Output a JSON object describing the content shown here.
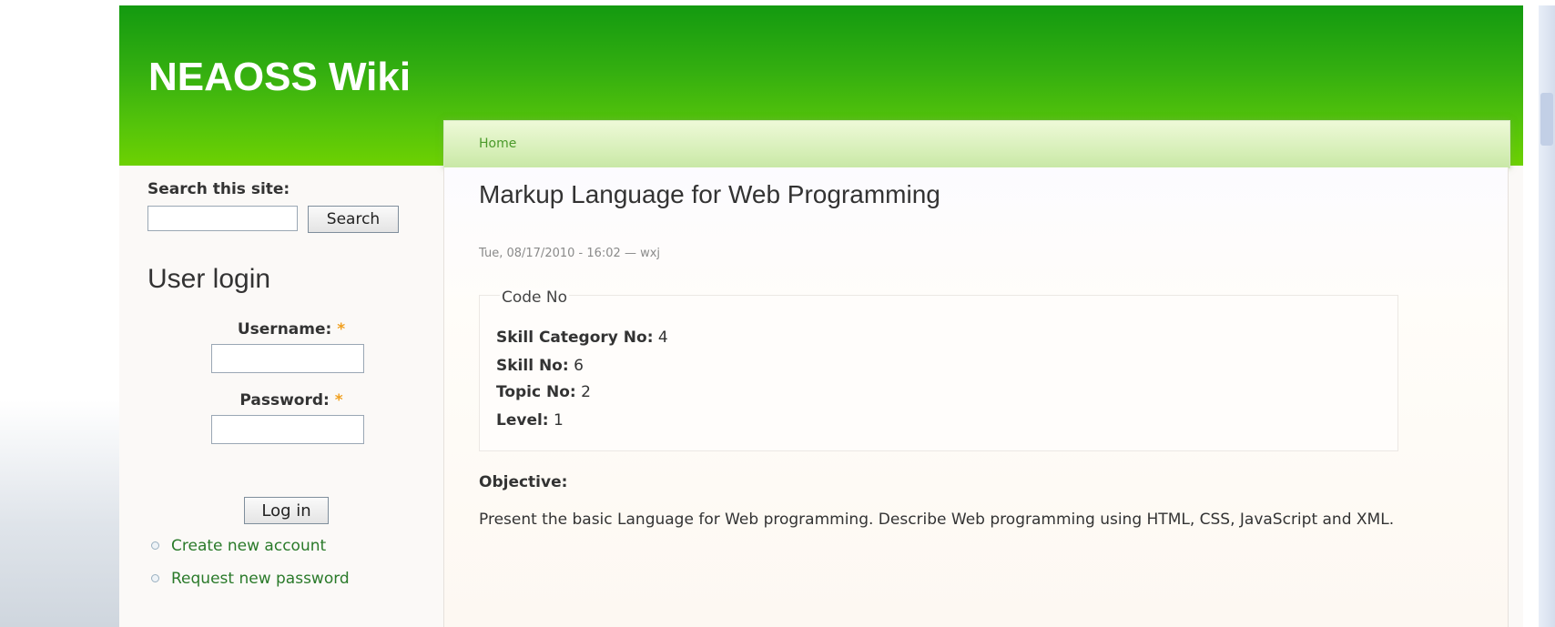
{
  "header": {
    "site_title": "NEAOSS Wiki"
  },
  "breadcrumb": {
    "home": "Home"
  },
  "sidebar": {
    "search_label": "Search this site:",
    "search_button": "Search",
    "search_value": "",
    "login_title": "User login",
    "username_label": "Username:",
    "password_label": "Password:",
    "required_mark": "*",
    "login_button": "Log in",
    "links": [
      "Create new account",
      "Request new password"
    ]
  },
  "content": {
    "title": "Markup Language for Web Programming",
    "submitted": "Tue, 08/17/2010 - 16:02 — wxj",
    "code_legend": "Code No",
    "code_fields": [
      {
        "label": "Skill Category No:",
        "value": "4"
      },
      {
        "label": "Skill No:",
        "value": "6"
      },
      {
        "label": "Topic No:",
        "value": "2"
      },
      {
        "label": "Level:",
        "value": "1"
      }
    ],
    "objective_label": "Objective:",
    "objective_text": "Present the basic Language for Web programming. Describe Web programming using HTML, CSS, JavaScript and XML."
  },
  "colors": {
    "header_green_top": "#139a10",
    "header_green_bottom": "#6dd102",
    "link_green": "#2a7a2a",
    "required_orange": "#f0a020"
  }
}
